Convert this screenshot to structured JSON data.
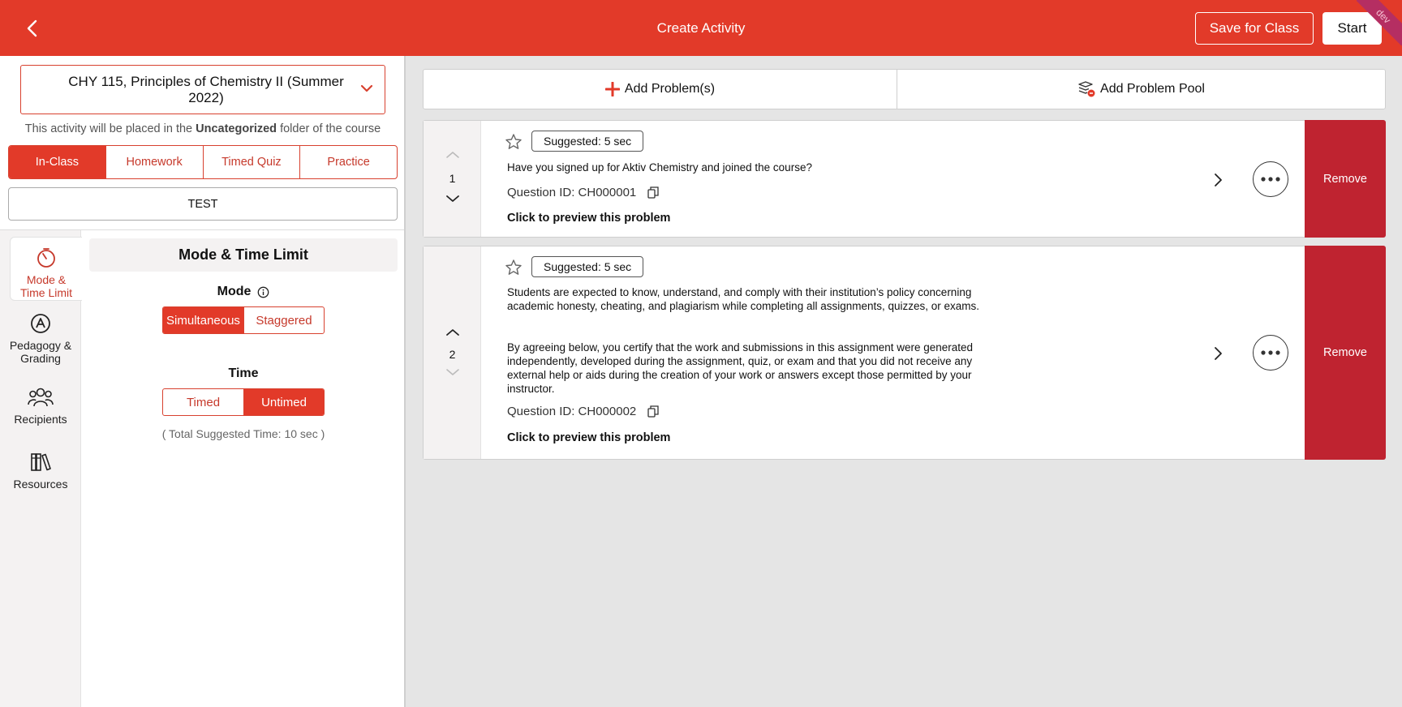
{
  "header": {
    "title": "Create Activity",
    "save_label": "Save for Class",
    "start_label": "Start",
    "ribbon_label": "dev",
    "accent_color": "#e23a29"
  },
  "course": {
    "selected": "CHY 115, Principles of Chemistry II (Summer 2022)",
    "placement_prefix": "This activity will be placed in the ",
    "placement_folder": "Uncategorized",
    "placement_suffix": " folder of the course"
  },
  "activity_types": [
    "In-Class",
    "Homework",
    "Timed Quiz",
    "Practice"
  ],
  "activity_type_selected": "In-Class",
  "activity_name": {
    "value": "TEST"
  },
  "side_nav": {
    "items": [
      {
        "label1": "Mode &",
        "label2": "Time Limit",
        "icon": "stopwatch-icon"
      },
      {
        "label1": "Pedagogy &",
        "label2": "Grading",
        "icon": "pedagogy-icon"
      },
      {
        "label1": "Recipients",
        "label2": "",
        "icon": "people-icon"
      },
      {
        "label1": "Resources",
        "label2": "",
        "icon": "books-icon"
      }
    ]
  },
  "mode_time": {
    "title": "Mode & Time Limit",
    "mode_label": "Mode",
    "mode_options": [
      "Simultaneous",
      "Staggered"
    ],
    "mode_selected": "Simultaneous",
    "time_label": "Time",
    "time_options": [
      "Timed",
      "Untimed"
    ],
    "time_selected": "Untimed",
    "total_time": "( Total Suggested Time: 10 sec )"
  },
  "toolbar": {
    "add_problem_label": "Add Problem(s)",
    "add_pool_label": "Add Problem Pool"
  },
  "problems": [
    {
      "order": "1",
      "suggested": "Suggested:  5 sec",
      "text": "Have you signed up for Aktiv Chemistry and joined the course?",
      "text2": "",
      "question_id": "Question ID: CH000001",
      "preview": "Click to preview this problem",
      "remove_label": "Remove"
    },
    {
      "order": "2",
      "suggested": "Suggested:  5 sec",
      "text": "Students are expected to know, understand, and comply with their institution’s policy concerning academic honesty, cheating, and plagiarism while completing all assignments, quizzes, or exams.",
      "text2": "By agreeing below, you certify that the work and submissions in this assignment were generated independently, developed during the assignment, quiz, or exam and that you did not receive any external help or aids during the creation of your work or answers except those permitted by your instructor.",
      "question_id": "Question ID: CH000002",
      "preview": "Click to preview this problem",
      "remove_label": "Remove"
    }
  ]
}
